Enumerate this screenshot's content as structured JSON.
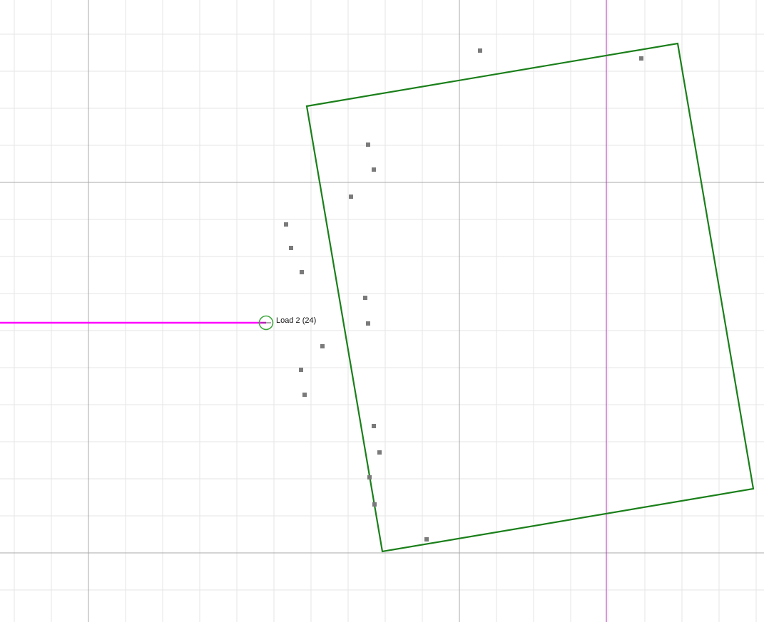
{
  "colors": {
    "background": "#ffffff",
    "minor_grid": "#e6e6e6",
    "major_grid": "#a8a8a8",
    "shape_outline": "#1a7f1a",
    "load_line": "#ff00ff",
    "guide_line": "#b030b0",
    "load_marker": "#3aa63a",
    "point_marker": "#7a7a7a"
  },
  "load": {
    "label": "Load 2 (24)",
    "icon": "circle-marker-icon"
  }
}
